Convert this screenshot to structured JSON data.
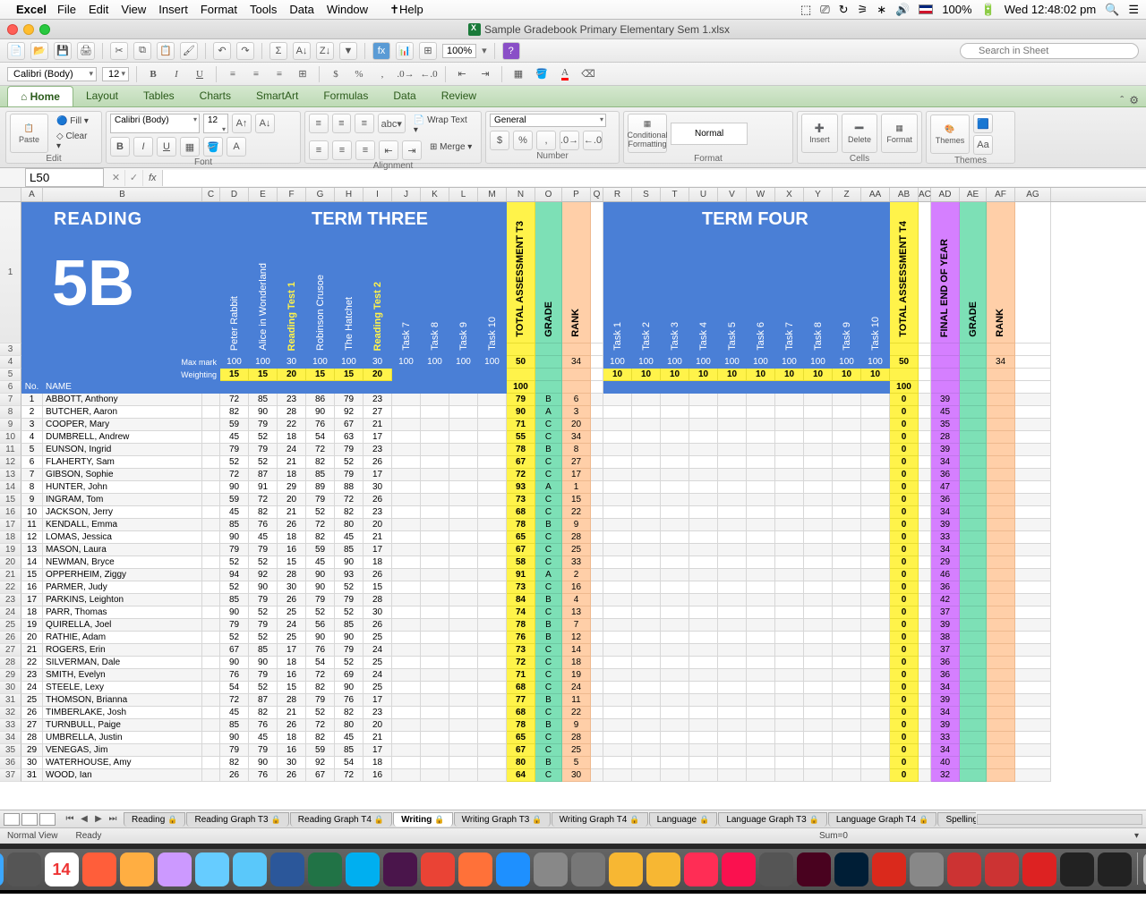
{
  "mac_menu": {
    "app": "Excel",
    "items": [
      "File",
      "Edit",
      "View",
      "Insert",
      "Format",
      "Tools",
      "Data",
      "Window",
      "Help"
    ],
    "battery": "100%",
    "clock": "Wed 12:48:02 pm"
  },
  "window": {
    "title": "Sample Gradebook Primary Elementary Sem 1.xlsx"
  },
  "toolbar2": {
    "zoom": "100%"
  },
  "search_placeholder": "Search in Sheet",
  "font_row": {
    "font": "Calibri (Body)",
    "size": "12"
  },
  "ribbon": {
    "tabs": [
      "Home",
      "Layout",
      "Tables",
      "Charts",
      "SmartArt",
      "Formulas",
      "Data",
      "Review"
    ],
    "active": "Home",
    "groups": [
      "Edit",
      "Font",
      "Alignment",
      "Number",
      "Format",
      "Cells",
      "Themes"
    ],
    "edit": {
      "paste": "Paste",
      "fill": "Fill",
      "clear": "Clear"
    },
    "font": {
      "name": "Calibri (Body)",
      "size": "12"
    },
    "align": {
      "wrap": "Wrap Text",
      "merge": "Merge"
    },
    "number": {
      "format": "General"
    },
    "format": {
      "cf": "Conditional Formatting",
      "normal": "Normal"
    },
    "cells": {
      "insert": "Insert",
      "delete": "Delete",
      "format": "Format"
    },
    "themes": {
      "themes": "Themes",
      "aa": "Aa"
    }
  },
  "formula_bar": {
    "cell_ref": "L50",
    "fx": "fx"
  },
  "columns": [
    "A",
    "B",
    "C",
    "D",
    "E",
    "F",
    "G",
    "H",
    "I",
    "J",
    "K",
    "L",
    "M",
    "N",
    "O",
    "P",
    "Q",
    "R",
    "S",
    "T",
    "U",
    "V",
    "W",
    "X",
    "Y",
    "Z",
    "AA",
    "AB",
    "AC",
    "AD",
    "AE",
    "AF",
    "AG"
  ],
  "header": {
    "reading": "READING",
    "class": "5B",
    "term3": "TERM THREE",
    "term4": "TERM FOUR",
    "tasks_t3": [
      "Peter Rabbit",
      "Alice in Wonderland",
      "Reading Test 1",
      "Robinson Crusoe",
      "The Hatchet",
      "Reading Test 2",
      "Task 7",
      "Task 8",
      "Task 9",
      "Task 10"
    ],
    "tasks_t4": [
      "Task 1",
      "Task 2",
      "Task 3",
      "Task 4",
      "Task 5",
      "Task 6",
      "Task 7",
      "Task 8",
      "Task 9",
      "Task 10"
    ],
    "tot_t3": "TOTAL ASSESSMENT T3",
    "grade": "GRADE",
    "rank": "RANK",
    "tot_t4": "TOTAL ASSESSMENT T4",
    "eoy": "FINAL END OF YEAR",
    "max_label": "Max mark",
    "wt_label": "Weighting",
    "max_t3": [
      "100",
      "100",
      "30",
      "100",
      "100",
      "30",
      "100",
      "100",
      "100",
      "100"
    ],
    "wt_t3": [
      "15",
      "15",
      "20",
      "15",
      "15",
      "20"
    ],
    "max_t4": [
      "100",
      "100",
      "100",
      "100",
      "100",
      "100",
      "100",
      "100",
      "100",
      "100"
    ],
    "wt_t4": [
      "10",
      "10",
      "10",
      "10",
      "10",
      "10",
      "10",
      "10",
      "10",
      "10"
    ],
    "tot_t3_max": "50",
    "tot_t3_100": "100",
    "rank_t3_hdr": "34",
    "tot_t4_max": "50",
    "tot_t4_100": "100",
    "rank_af": "34",
    "no_label": "No.",
    "name_label": "NAME"
  },
  "students": [
    {
      "n": 1,
      "name": "ABBOTT, Anthony",
      "s": [
        72,
        85,
        23,
        86,
        79,
        23
      ],
      "t3": 79,
      "g": "B",
      "r": 6,
      "t4": 0,
      "eoy": 39
    },
    {
      "n": 2,
      "name": "BUTCHER, Aaron",
      "s": [
        82,
        90,
        28,
        90,
        92,
        27
      ],
      "t3": 90,
      "g": "A",
      "r": 3,
      "t4": 0,
      "eoy": 45
    },
    {
      "n": 3,
      "name": "COOPER, Mary",
      "s": [
        59,
        79,
        22,
        76,
        67,
        21
      ],
      "t3": 71,
      "g": "C",
      "r": 20,
      "t4": 0,
      "eoy": 35
    },
    {
      "n": 4,
      "name": "DUMBRELL, Andrew",
      "s": [
        45,
        52,
        18,
        54,
        63,
        17
      ],
      "t3": 55,
      "g": "C",
      "r": 34,
      "t4": 0,
      "eoy": 28
    },
    {
      "n": 5,
      "name": "EUNSON, Ingrid",
      "s": [
        79,
        79,
        24,
        72,
        79,
        23
      ],
      "t3": 78,
      "g": "B",
      "r": 8,
      "t4": 0,
      "eoy": 39
    },
    {
      "n": 6,
      "name": "FLAHERTY, Sam",
      "s": [
        52,
        52,
        21,
        82,
        52,
        26
      ],
      "t3": 67,
      "g": "C",
      "r": 27,
      "t4": 0,
      "eoy": 34
    },
    {
      "n": 7,
      "name": "GIBSON, Sophie",
      "s": [
        72,
        87,
        18,
        85,
        79,
        17
      ],
      "t3": 72,
      "g": "C",
      "r": 17,
      "t4": 0,
      "eoy": 36
    },
    {
      "n": 8,
      "name": "HUNTER, John",
      "s": [
        90,
        91,
        29,
        89,
        88,
        30
      ],
      "t3": 93,
      "g": "A",
      "r": 1,
      "t4": 0,
      "eoy": 47
    },
    {
      "n": 9,
      "name": "INGRAM, Tom",
      "s": [
        59,
        72,
        20,
        79,
        72,
        26
      ],
      "t3": 73,
      "g": "C",
      "r": 15,
      "t4": 0,
      "eoy": 36
    },
    {
      "n": 10,
      "name": "JACKSON, Jerry",
      "s": [
        45,
        82,
        21,
        52,
        82,
        23
      ],
      "t3": 68,
      "g": "C",
      "r": 22,
      "t4": 0,
      "eoy": 34
    },
    {
      "n": 11,
      "name": "KENDALL, Emma",
      "s": [
        85,
        76,
        26,
        72,
        80,
        20
      ],
      "t3": 78,
      "g": "B",
      "r": 9,
      "t4": 0,
      "eoy": 39
    },
    {
      "n": 12,
      "name": "LOMAS, Jessica",
      "s": [
        90,
        45,
        18,
        82,
        45,
        21
      ],
      "t3": 65,
      "g": "C",
      "r": 28,
      "t4": 0,
      "eoy": 33
    },
    {
      "n": 13,
      "name": "MASON, Laura",
      "s": [
        79,
        79,
        16,
        59,
        85,
        17
      ],
      "t3": 67,
      "g": "C",
      "r": 25,
      "t4": 0,
      "eoy": 34
    },
    {
      "n": 14,
      "name": "NEWMAN, Bryce",
      "s": [
        52,
        52,
        15,
        45,
        90,
        18
      ],
      "t3": 58,
      "g": "C",
      "r": 33,
      "t4": 0,
      "eoy": 29
    },
    {
      "n": 15,
      "name": "OPPERHEIM, Ziggy",
      "s": [
        94,
        92,
        28,
        90,
        93,
        26
      ],
      "t3": 91,
      "g": "A",
      "r": 2,
      "t4": 0,
      "eoy": 46
    },
    {
      "n": 16,
      "name": "PARMER, Judy",
      "s": [
        52,
        90,
        30,
        90,
        52,
        15
      ],
      "t3": 73,
      "g": "C",
      "r": 16,
      "t4": 0,
      "eoy": 36
    },
    {
      "n": 17,
      "name": "PARKINS, Leighton",
      "s": [
        85,
        79,
        26,
        79,
        79,
        28
      ],
      "t3": 84,
      "g": "B",
      "r": 4,
      "t4": 0,
      "eoy": 42
    },
    {
      "n": 18,
      "name": "PARR, Thomas",
      "s": [
        90,
        52,
        25,
        52,
        52,
        30
      ],
      "t3": 74,
      "g": "C",
      "r": 13,
      "t4": 0,
      "eoy": 37
    },
    {
      "n": 19,
      "name": "QUIRELLA, Joel",
      "s": [
        79,
        79,
        24,
        56,
        85,
        26
      ],
      "t3": 78,
      "g": "B",
      "r": 7,
      "t4": 0,
      "eoy": 39
    },
    {
      "n": 20,
      "name": "RATHIE, Adam",
      "s": [
        52,
        52,
        25,
        90,
        90,
        25
      ],
      "t3": 76,
      "g": "B",
      "r": 12,
      "t4": 0,
      "eoy": 38
    },
    {
      "n": 21,
      "name": "ROGERS, Erin",
      "s": [
        67,
        85,
        17,
        76,
        79,
        24
      ],
      "t3": 73,
      "g": "C",
      "r": 14,
      "t4": 0,
      "eoy": 37
    },
    {
      "n": 22,
      "name": "SILVERMAN, Dale",
      "s": [
        90,
        90,
        18,
        54,
        52,
        25
      ],
      "t3": 72,
      "g": "C",
      "r": 18,
      "t4": 0,
      "eoy": 36
    },
    {
      "n": 23,
      "name": "SMITH, Evelyn",
      "s": [
        76,
        79,
        16,
        72,
        69,
        24
      ],
      "t3": 71,
      "g": "C",
      "r": 19,
      "t4": 0,
      "eoy": 36
    },
    {
      "n": 24,
      "name": "STEELE, Lexy",
      "s": [
        54,
        52,
        15,
        82,
        90,
        25
      ],
      "t3": 68,
      "g": "C",
      "r": 24,
      "t4": 0,
      "eoy": 34
    },
    {
      "n": 25,
      "name": "THOMSON, Brianna",
      "s": [
        72,
        87,
        28,
        79,
        76,
        17
      ],
      "t3": 77,
      "g": "B",
      "r": 11,
      "t4": 0,
      "eoy": 39
    },
    {
      "n": 26,
      "name": "TIMBERLAKE, Josh",
      "s": [
        45,
        82,
        21,
        52,
        82,
        23
      ],
      "t3": 68,
      "g": "C",
      "r": 22,
      "t4": 0,
      "eoy": 34
    },
    {
      "n": 27,
      "name": "TURNBULL, Paige",
      "s": [
        85,
        76,
        26,
        72,
        80,
        20
      ],
      "t3": 78,
      "g": "B",
      "r": 9,
      "t4": 0,
      "eoy": 39
    },
    {
      "n": 28,
      "name": "UMBRELLA, Justin",
      "s": [
        90,
        45,
        18,
        82,
        45,
        21
      ],
      "t3": 65,
      "g": "C",
      "r": 28,
      "t4": 0,
      "eoy": 33
    },
    {
      "n": 29,
      "name": "VENEGAS, Jim",
      "s": [
        79,
        79,
        16,
        59,
        85,
        17
      ],
      "t3": 67,
      "g": "C",
      "r": 25,
      "t4": 0,
      "eoy": 34
    },
    {
      "n": 30,
      "name": "WATERHOUSE, Amy",
      "s": [
        82,
        90,
        30,
        92,
        54,
        18
      ],
      "t3": 80,
      "g": "B",
      "r": 5,
      "t4": 0,
      "eoy": 40
    },
    {
      "n": 31,
      "name": "WOOD, Ian",
      "s": [
        26,
        76,
        26,
        67,
        72,
        16
      ],
      "t3": 64,
      "g": "C",
      "r": 30,
      "t4": 0,
      "eoy": 32
    }
  ],
  "sheets": {
    "tabs": [
      "Reading",
      "Reading Graph T3",
      "Reading Graph T4",
      "Writing",
      "Writing Graph T3",
      "Writing Graph T4",
      "Language",
      "Language Graph T3",
      "Language Graph T4",
      "Spelling",
      "Spe"
    ],
    "active": "Writing"
  },
  "status": {
    "view": "Normal View",
    "ready": "Ready",
    "sum": "Sum=0"
  },
  "dock_icons": [
    "finder",
    "dvd",
    "cal",
    "ical",
    "photos",
    "music",
    "cloud",
    "folder",
    "word",
    "excel",
    "skype",
    "slack",
    "chrome",
    "firefox",
    "safari",
    "sys",
    "settings",
    "pencil",
    "pencil2",
    "cal2",
    "music2",
    "film",
    "indesign",
    "ps",
    "adobe",
    "camera",
    "paint",
    "paint2",
    "red",
    "tv",
    "tv2",
    "trash"
  ]
}
